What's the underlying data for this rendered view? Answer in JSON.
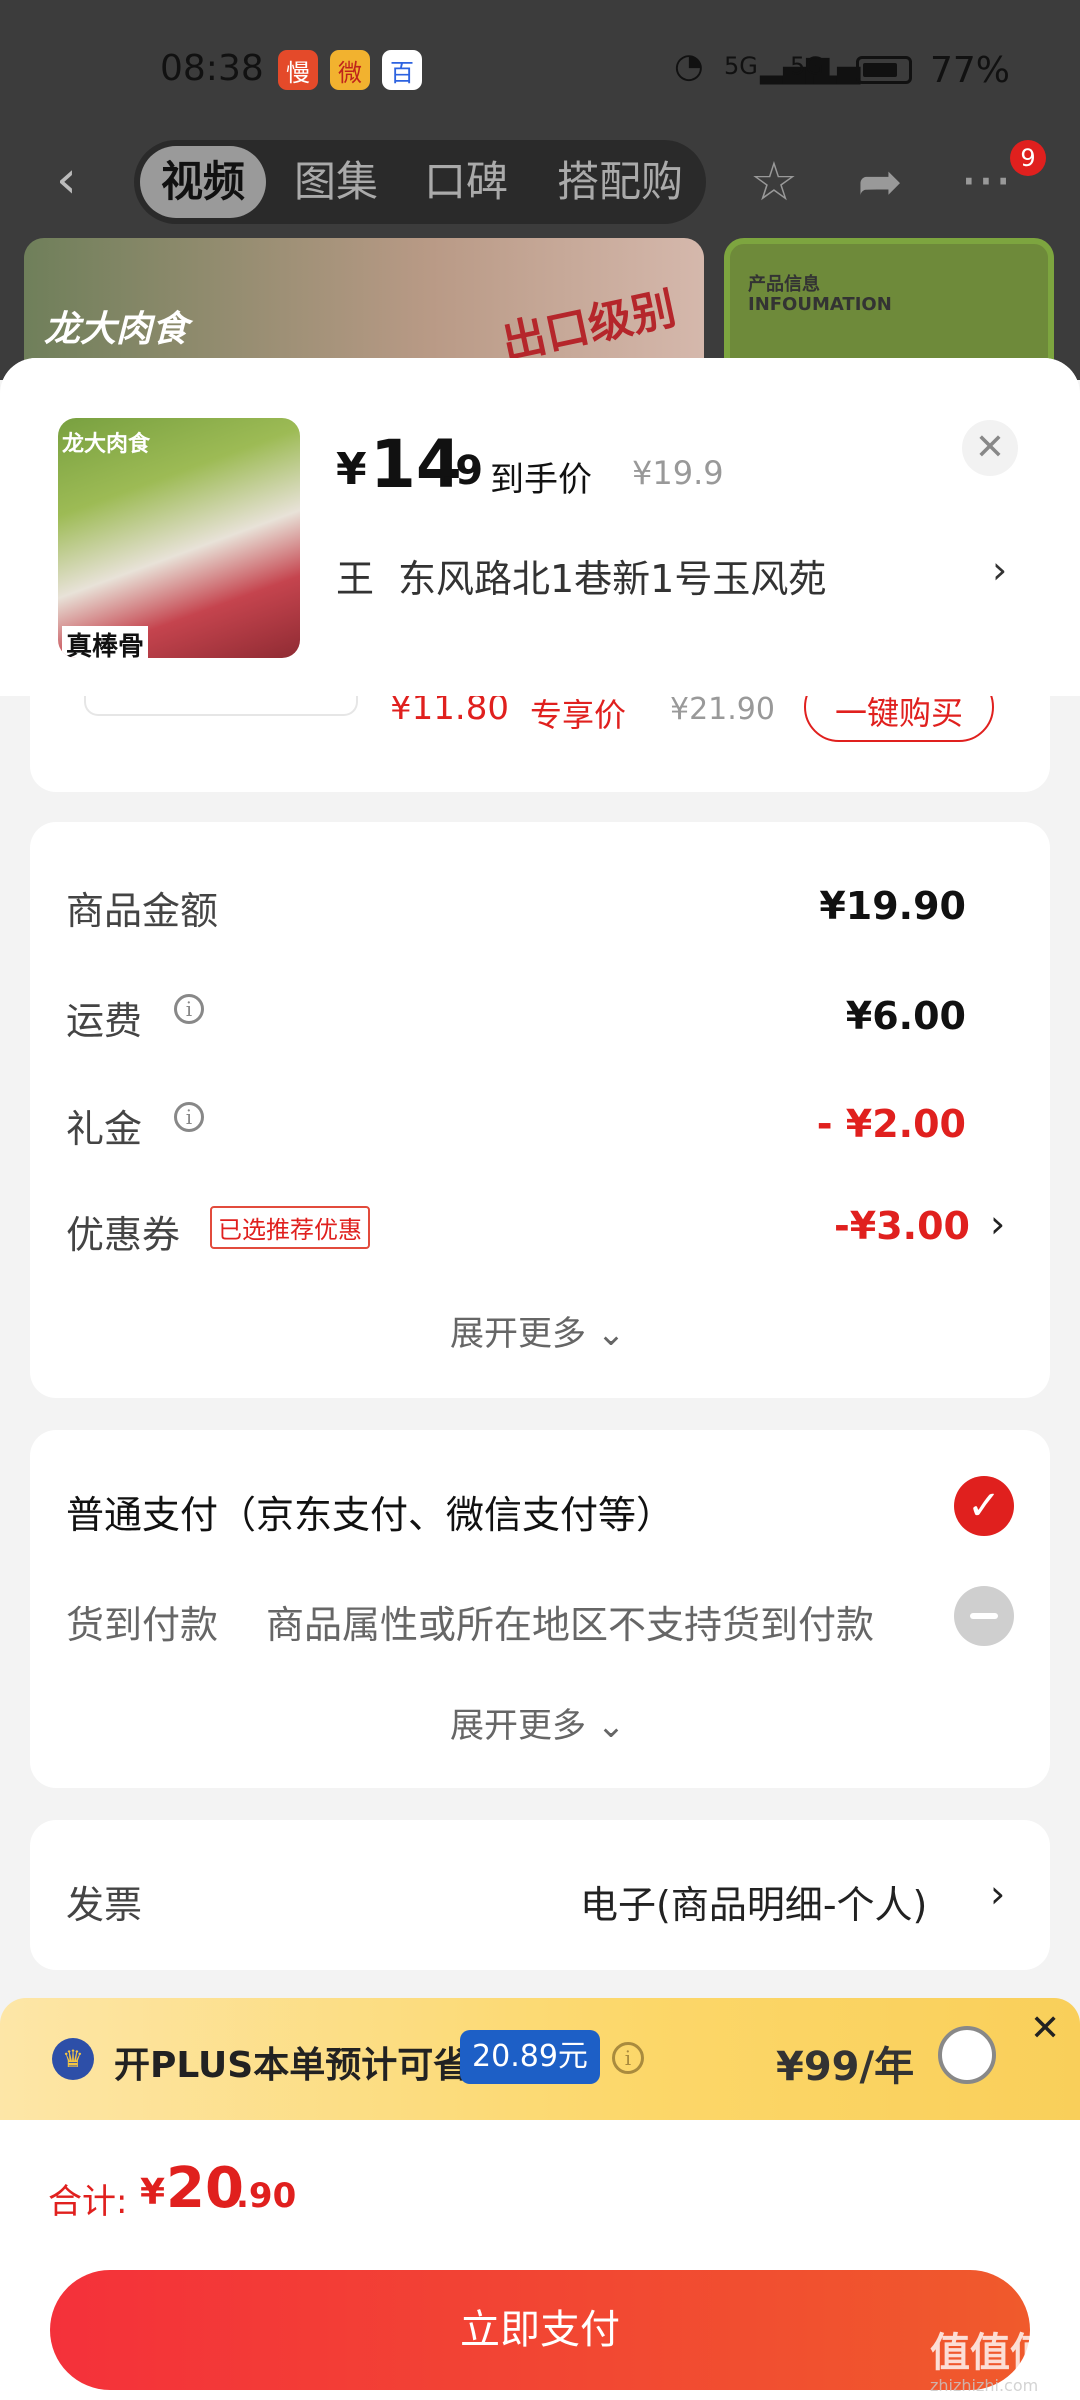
{
  "status_bar": {
    "time": "08:38",
    "apps": [
      "慢",
      "微",
      "百"
    ],
    "signal1": "5G",
    "signal2": "5G",
    "battery": "77%"
  },
  "nav": {
    "back": "‹",
    "tabs": [
      "视频",
      "图集",
      "口碑",
      "搭配购"
    ],
    "active_tab": "视频",
    "star": "☆",
    "share": "➦",
    "more": "···",
    "badge": "9"
  },
  "banner": {
    "brand": "龙大肉食",
    "stamp": "出口级别",
    "info_title": "产品信息",
    "info_sub": "INFOUMATION"
  },
  "product": {
    "thumb_brand": "龙大肉食",
    "thumb_tag": "真棒骨",
    "price_currency": "¥",
    "price_int": "14",
    "price_dec": ".9",
    "price_label": "到手价",
    "original_price": "¥19.9",
    "close": "✕"
  },
  "address": {
    "name": "王",
    "text": "东风路北1巷新1号玉风苑",
    "chevron": "›"
  },
  "recommend": {
    "price": "¥11.80",
    "label": "专享价",
    "original": "¥21.90",
    "button": "一键购买"
  },
  "summary": {
    "goods_label": "商品金额",
    "goods_value": "¥19.90",
    "freight_label": "运费",
    "freight_value": "¥6.00",
    "gift_label": "礼金",
    "gift_value": "- ¥2.00",
    "coupon_label": "优惠券",
    "coupon_tag": "已选推荐优惠",
    "coupon_value": "-¥3.00",
    "coupon_chevron": "›",
    "expand": "展开更多 ⌄"
  },
  "payment": {
    "normal_label": "普通支付（京东支付、微信支付等）",
    "cod_label": "货到付款",
    "cod_note": "商品属性或所在地区不支持货到付款",
    "expand": "展开更多 ⌄"
  },
  "invoice": {
    "label": "发票",
    "value": "电子(商品明细-个人)",
    "chevron": "›"
  },
  "plus": {
    "text": "开PLUS本单预计可省",
    "amount": "20.89元",
    "price": "¥99/年",
    "close": "✕"
  },
  "footer": {
    "total_label": "合计:",
    "total_currency": "¥",
    "total_int": "20",
    "total_dec": ".90",
    "pay_button": "立即支付"
  },
  "watermark": {
    "main": "值值值",
    "sub": "zhizhizhi.com"
  }
}
